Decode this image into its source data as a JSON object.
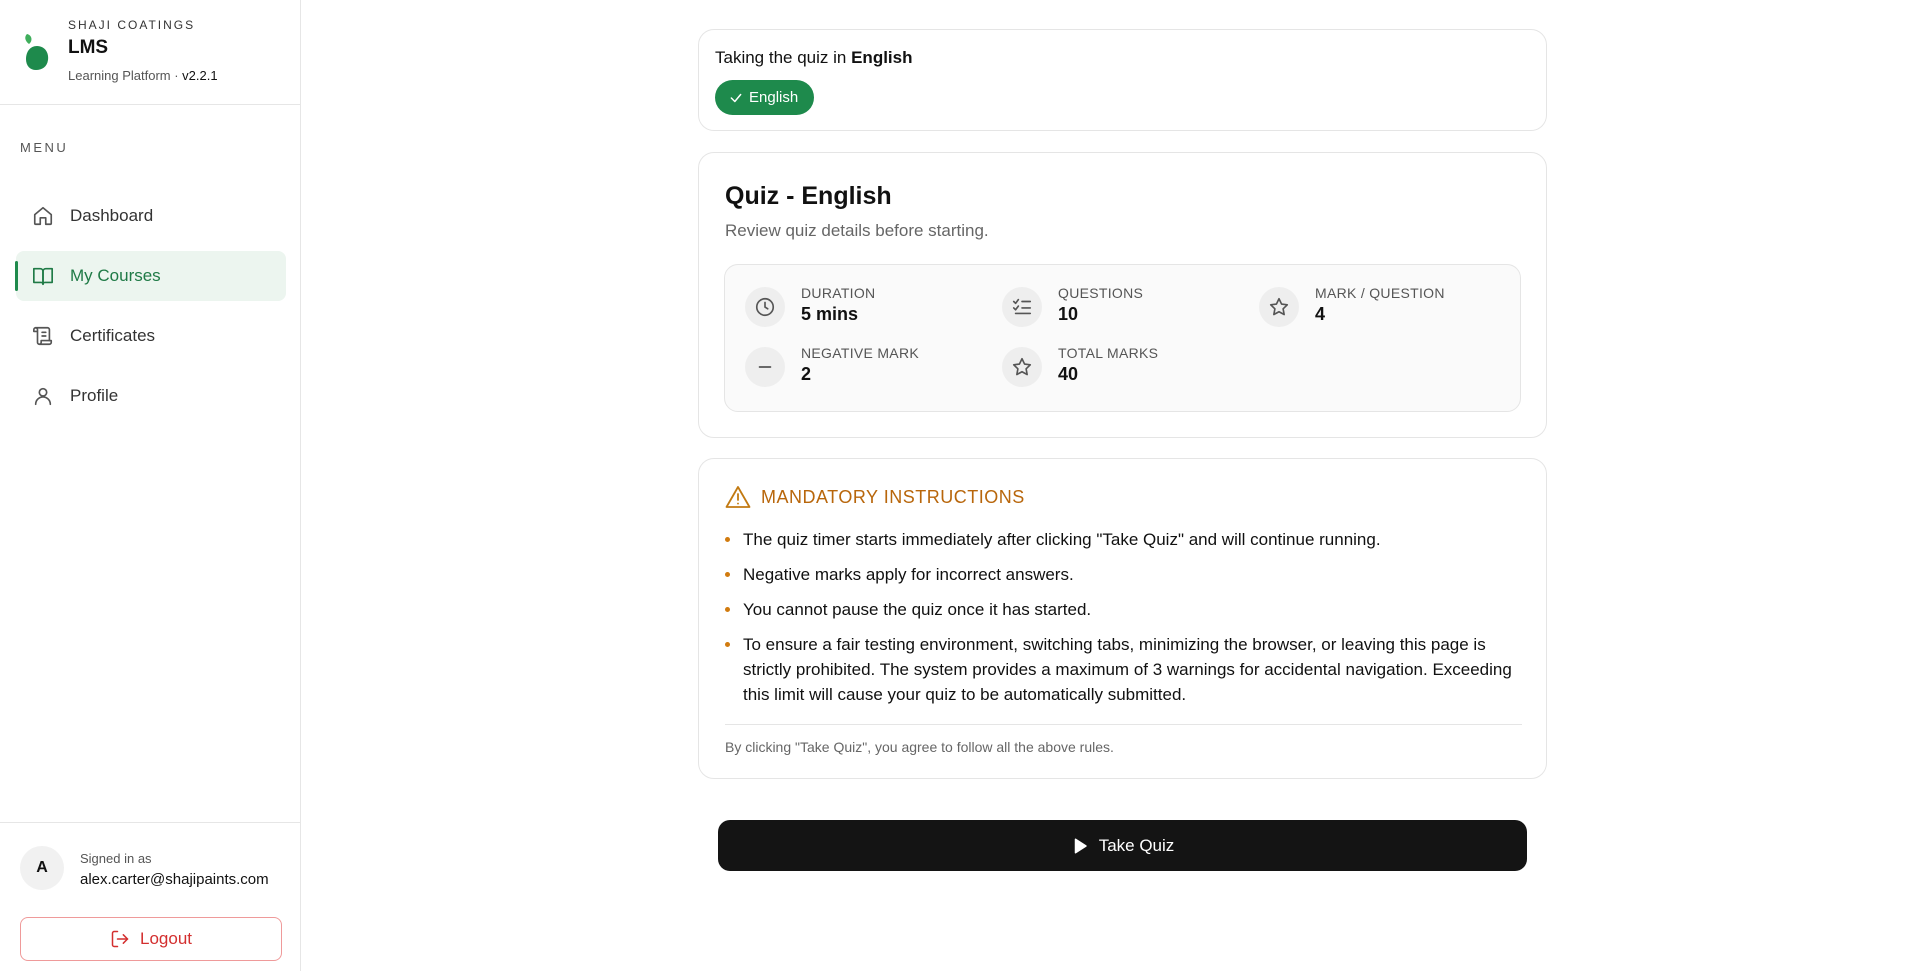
{
  "brand": {
    "company": "SHAJI COATINGS",
    "name": "LMS",
    "subtitle": "Learning Platform · ",
    "version": "v2.2.1"
  },
  "sidebar": {
    "menu_title": "MENU",
    "items": [
      {
        "label": "Dashboard",
        "icon": "home-icon"
      },
      {
        "label": "My Courses",
        "icon": "book-open-icon",
        "active": true
      },
      {
        "label": "Certificates",
        "icon": "scroll-icon"
      },
      {
        "label": "Profile",
        "icon": "user-icon"
      }
    ],
    "user": {
      "avatar_initial": "A",
      "signed_in_label": "Signed in as",
      "email": "alex.carter@shajipaints.com"
    },
    "logout_label": "Logout"
  },
  "language": {
    "prefix": "Taking the quiz in ",
    "current": "English",
    "chip_label": "English"
  },
  "quiz": {
    "title": "Quiz - English",
    "subtitle": "Review quiz details before starting.",
    "stats": [
      {
        "label": "DURATION",
        "value": "5 mins",
        "icon": "clock-icon"
      },
      {
        "label": "QUESTIONS",
        "value": "10",
        "icon": "list-checks-icon"
      },
      {
        "label": "MARK / QUESTION",
        "value": "4",
        "icon": "star-icon"
      },
      {
        "label": "NEGATIVE MARK",
        "value": "2",
        "icon": "minus-icon"
      },
      {
        "label": "TOTAL MARKS",
        "value": "40",
        "icon": "star-icon"
      }
    ]
  },
  "instructions": {
    "title": "MANDATORY INSTRUCTIONS",
    "items": [
      "The quiz timer starts immediately after clicking \"Take Quiz\" and will continue running.",
      "Negative marks apply for incorrect answers.",
      "You cannot pause the quiz once it has started.",
      "To ensure a fair testing environment, switching tabs, minimizing the browser, or leaving this page is strictly prohibited. The system provides a maximum of 3 warnings for accidental navigation. Exceeding this limit will cause your quiz to be automatically submitted."
    ],
    "footer": "By clicking \"Take Quiz\", you agree to follow all the above rules."
  },
  "actions": {
    "take_quiz_label": "Take Quiz"
  },
  "colors": {
    "accent_green": "#1e8a4c",
    "warning_orange": "#b8660b",
    "danger_red": "#d32f2f"
  }
}
